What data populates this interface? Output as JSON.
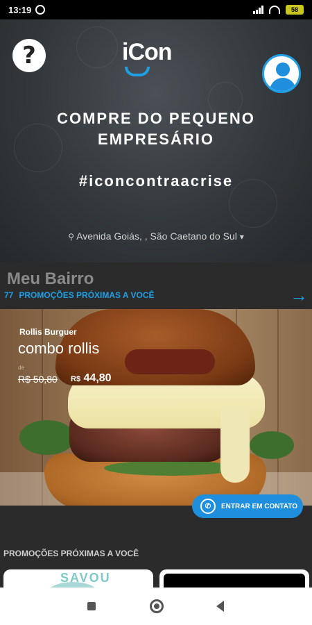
{
  "status_bar": {
    "time": "13:19",
    "battery": "58"
  },
  "header": {
    "help_label": "?",
    "logo_text": "iCon"
  },
  "hero": {
    "headline_line1": "COMPRE DO PEQUENO",
    "headline_line2": "EMPRESÁRIO",
    "hashtag": "#iconcontraacrise",
    "location": "Avenida Goiás, , São Caetano do Sul"
  },
  "bairro": {
    "title": "Meu Bairro",
    "count": "77",
    "subtitle": "PROMOÇÕES PRÓXIMAS A VOCÊ"
  },
  "promo": {
    "store": "Rollis Burguer",
    "product": "combo rollis",
    "price_label": "de",
    "old_price": "R$ 50,80",
    "new_currency": "R$",
    "new_price": "44,80",
    "contact_label": "ENTRAR EM CONTATO"
  },
  "section": {
    "title": "PROMOÇÕES PRÓXIMAS A VOCÊ",
    "card_a_text": "SAVOU"
  },
  "colors": {
    "accent": "#1fa0e6",
    "button": "#1f8fdd",
    "background": "#2b2b2b"
  },
  "icons": [
    "whatsapp-icon",
    "signal-icon",
    "wifi-icon",
    "battery-icon",
    "help-icon",
    "profile-icon",
    "pin-icon",
    "caret-down-icon",
    "arrow-right-icon"
  ]
}
